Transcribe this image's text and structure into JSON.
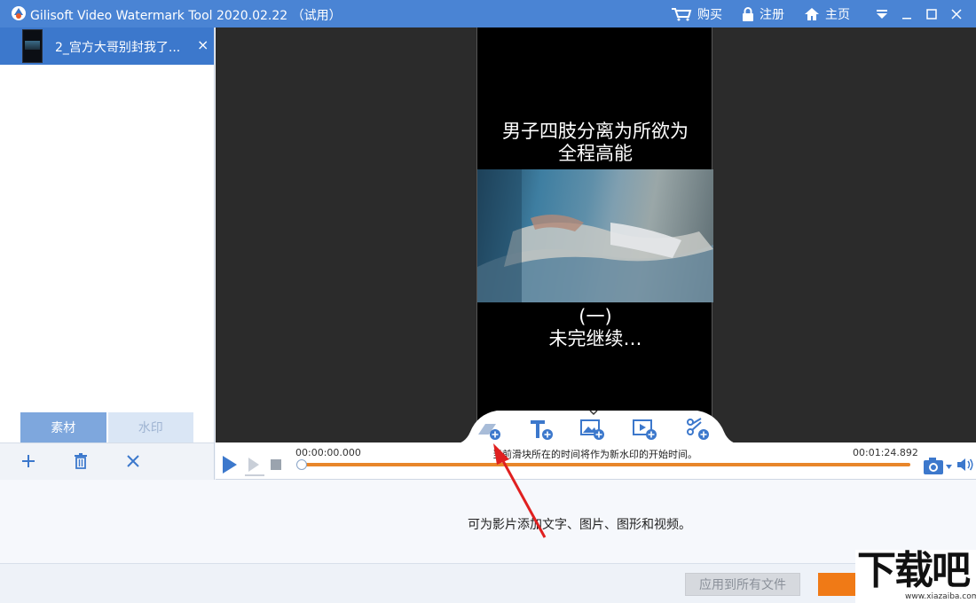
{
  "window": {
    "title": "Gilisoft Video Watermark Tool 2020.02.22 （试用）",
    "menu": [
      {
        "label": "购买",
        "icon": "cart-icon"
      },
      {
        "label": "注册",
        "icon": "lock-icon"
      },
      {
        "label": "主页",
        "icon": "home-icon"
      }
    ],
    "controls": [
      "dropdown-icon",
      "minimize-icon",
      "maximize-icon",
      "close-icon"
    ],
    "accent_color": "#4a84d4"
  },
  "file_list": {
    "items": [
      {
        "name": "2_宫方大哥别封我了...",
        "close": "×"
      }
    ]
  },
  "left_tabs": {
    "material": "素材",
    "watermark": "水印"
  },
  "left_actions": [
    "add-icon",
    "delete-icon",
    "remove-icon"
  ],
  "preview": {
    "caption_top_line1": "男子四肢分离为所欲为",
    "caption_top_line2": "全程高能",
    "caption_bottom_line1": "(一)",
    "caption_bottom_line2": "未完继续…"
  },
  "watermark_toolbar": [
    "add-shape-icon",
    "add-text-icon",
    "add-image-icon",
    "add-video-icon",
    "add-mosaic-icon"
  ],
  "timeline": {
    "start_time": "00:00:00.000",
    "end_time": "00:01:24.892",
    "hint": "当前滑块所在的时间将作为新水印的开始时间。",
    "progress": 0,
    "accent": "#e8862a"
  },
  "info": {
    "text": "可为影片添加文字、图片、图形和视频。"
  },
  "bottom": {
    "apply_all": "应用到所有文件"
  },
  "watermark_logo": {
    "main": "下载吧",
    "url": "www.xiazaiba.com"
  }
}
